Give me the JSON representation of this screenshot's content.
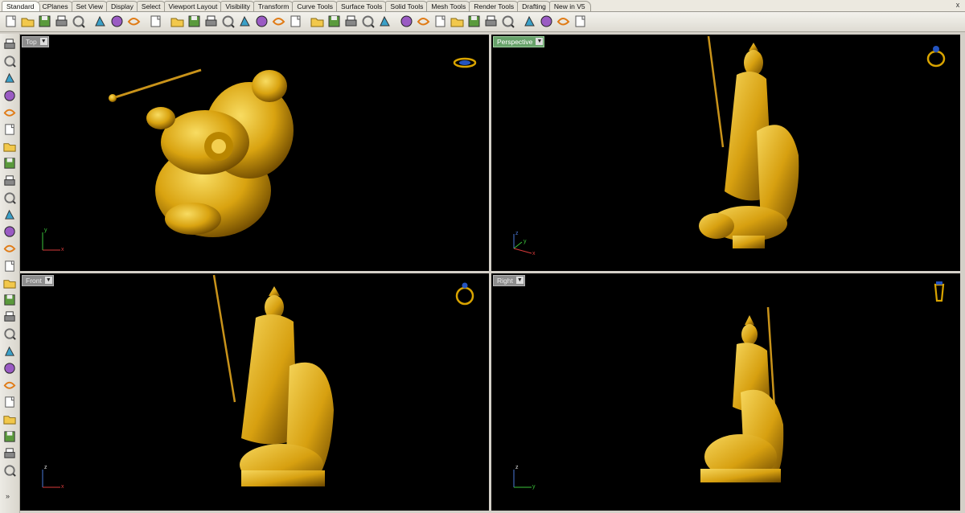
{
  "tabs": [
    "Standard",
    "CPlanes",
    "Set View",
    "Display",
    "Select",
    "Viewport Layout",
    "Visibility",
    "Transform",
    "Curve Tools",
    "Surface Tools",
    "Solid Tools",
    "Mesh Tools",
    "Render Tools",
    "Drafting",
    "New in V5"
  ],
  "tabs_close": "x",
  "toolbar_icons": [
    "new-file-icon",
    "open-file-icon",
    "save-icon",
    "print-icon",
    "import-icon",
    "cut-icon",
    "copy-icon",
    "paste-icon",
    "undo-icon",
    "pan-icon",
    "move-view-icon",
    "zoom-icon",
    "zoom-window-icon",
    "zoom-extents-icon",
    "zoom-selected-icon",
    "rotate-view-icon",
    "four-viewports-icon",
    "car-view-icon",
    "named-views-icon",
    "cplane-icon",
    "grid-snap-icon",
    "show-objects-icon",
    "light-bulb-icon",
    "layer-icon",
    "properties-icon",
    "color-wheel-icon",
    "render-preview-icon",
    "render-icon",
    "material-sphere-icon",
    "options-icon",
    "settings-icon",
    "plugins-icon",
    "help-icon"
  ],
  "sidebar_icons": [
    "select-arrow-icon",
    "point-icon",
    "polyline-icon",
    "curve-icon",
    "circle-icon",
    "ellipse-icon",
    "arc-icon",
    "rectangle-icon",
    "polygon-icon",
    "curve-fillet-icon",
    "surface-icon",
    "extrude-icon",
    "box-solid-icon",
    "boolean-icon",
    "cylinder-icon",
    "mesh-icon",
    "transform-icon",
    "explode-icon",
    "sweep-icon",
    "align-icon",
    "rotate-icon",
    "array-icon",
    "blend-icon",
    "text-icon",
    "dimension-icon",
    "group-icon"
  ],
  "sidebar_more": "»",
  "viewports": [
    {
      "id": "top",
      "label": "Top",
      "active": false,
      "axes": [
        "y",
        "x"
      ]
    },
    {
      "id": "perspective",
      "label": "Perspective",
      "active": true,
      "axes": [
        "z",
        "y",
        "x"
      ]
    },
    {
      "id": "front",
      "label": "Front",
      "active": false,
      "axes": [
        "z",
        "x"
      ]
    },
    {
      "id": "right",
      "label": "Right",
      "active": false,
      "axes": [
        "z",
        "y"
      ]
    }
  ],
  "colors": {
    "gold": "#e3b21a",
    "gold_light": "#f6d65c",
    "gold_dark": "#8a5f00",
    "viewport_bg": "#000000",
    "active_label": "#67a26a"
  }
}
